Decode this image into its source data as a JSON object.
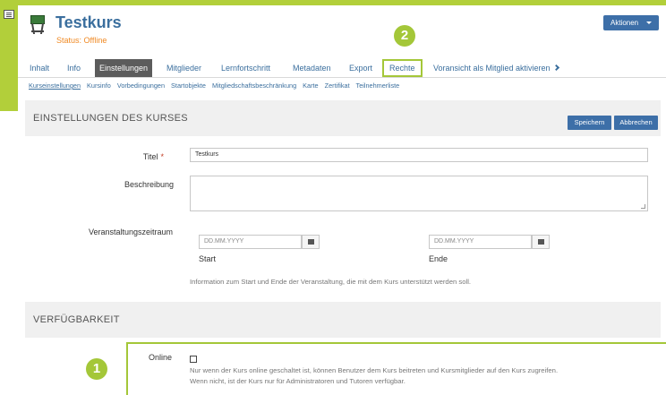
{
  "header": {
    "title": "Testkurs",
    "status": "Status: Offline",
    "actions_label": "Aktionen"
  },
  "tabs": [
    {
      "label": "Inhalt"
    },
    {
      "label": "Info"
    },
    {
      "label": "Einstellungen",
      "active": true
    },
    {
      "label": "Mitglieder"
    },
    {
      "label": "Lernfortschritt"
    },
    {
      "label": "Metadaten"
    },
    {
      "label": "Export"
    },
    {
      "label": "Rechte",
      "highlighted": true
    },
    {
      "label": "Voransicht als Mitglied aktivieren"
    }
  ],
  "subtabs": [
    {
      "label": "Kurseinstellungen",
      "active": true
    },
    {
      "label": "Kursinfo"
    },
    {
      "label": "Vorbedingungen"
    },
    {
      "label": "Startobjekte"
    },
    {
      "label": "Mitgliedschaftsbeschränkung"
    },
    {
      "label": "Karte"
    },
    {
      "label": "Zertifikat"
    },
    {
      "label": "Teilnehmerliste"
    }
  ],
  "settings": {
    "heading": "EINSTELLUNGEN DES KURSES",
    "save_label": "Speichern",
    "cancel_label": "Abbrechen",
    "title_label": "Titel",
    "required_mark": "*",
    "title_value": "Testkurs",
    "description_label": "Beschreibung",
    "period_label": "Veranstaltungszeitraum",
    "start_placeholder": "DD.MM.YYYY",
    "end_placeholder": "DD.MM.YYYY",
    "start_label": "Start",
    "end_label": "Ende",
    "period_info": "Information zum Start und Ende der Veranstaltung, die mit dem Kurs unterstützt werden soll."
  },
  "availability": {
    "heading": "VERFÜGBARKEIT",
    "online_label": "Online",
    "online_info_1": "Nur wenn der Kurs online geschaltet ist, können Benutzer dem Kurs beitreten und Kursmitglieder auf den Kurs zugreifen.",
    "online_info_2": "Wenn nicht, ist der Kurs nur für Administratoren und Tutoren verfügbar."
  },
  "badges": {
    "one": "1",
    "two": "2"
  },
  "colors": {
    "accent_green": "#a4c739",
    "link_blue": "#3b6f9e",
    "button_blue": "#3d6fa8",
    "status_orange": "#f08a24"
  }
}
